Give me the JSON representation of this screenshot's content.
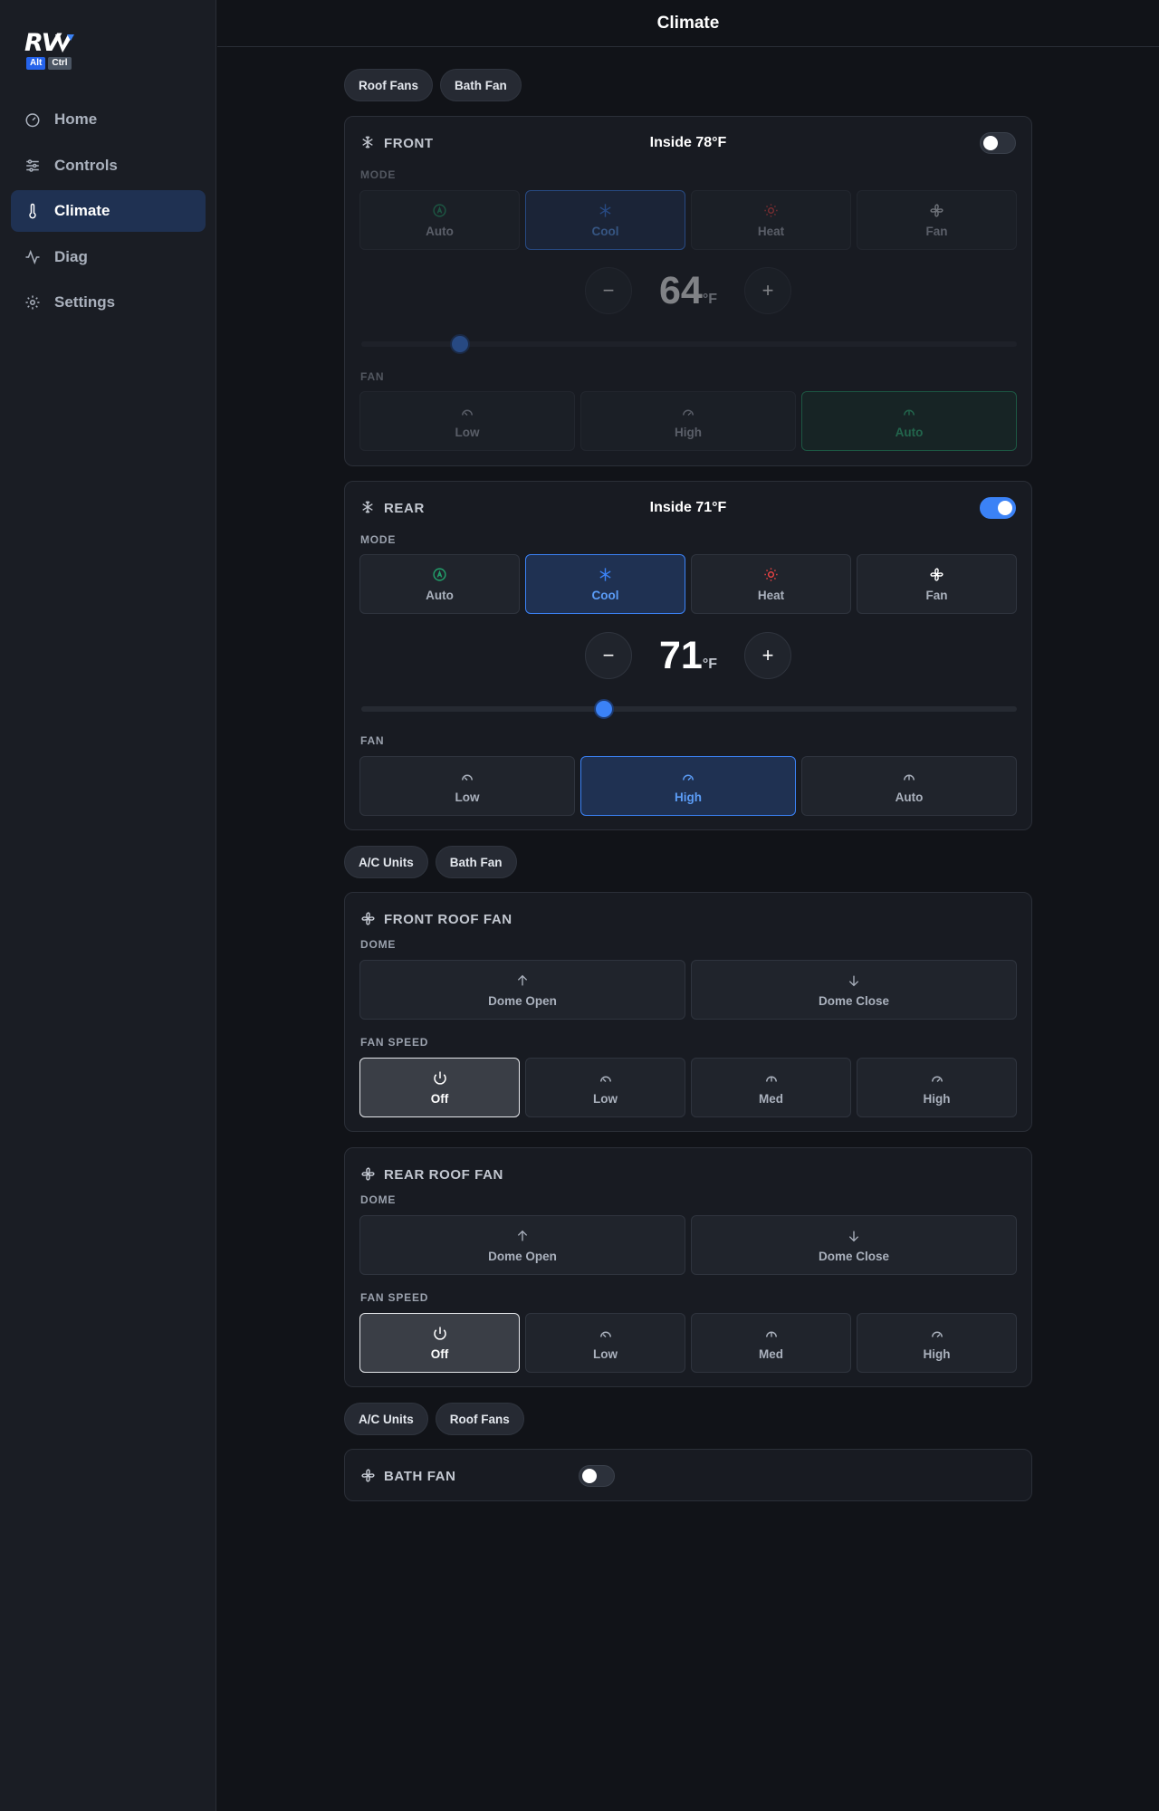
{
  "app": {
    "logo_text": "RV",
    "logo_badges": [
      "Alt",
      "Ctrl"
    ],
    "title": "Climate"
  },
  "sidebar": {
    "items": [
      {
        "label": "Home",
        "icon": "gauge-icon",
        "active": false
      },
      {
        "label": "Controls",
        "icon": "sliders-icon",
        "active": false
      },
      {
        "label": "Climate",
        "icon": "thermometer-icon",
        "active": true
      },
      {
        "label": "Diag",
        "icon": "activity-icon",
        "active": false
      },
      {
        "label": "Settings",
        "icon": "gear-icon",
        "active": false
      }
    ]
  },
  "ac_section": {
    "pills": [
      "Roof Fans",
      "Bath Fan"
    ],
    "front": {
      "name": "FRONT",
      "inside_temp": "Inside 78°F",
      "enabled": false,
      "mode_label": "MODE",
      "modes": [
        "Auto",
        "Cool",
        "Heat",
        "Fan"
      ],
      "selected_mode": "Cool",
      "setpoint": "64",
      "unit": "°F",
      "slider_fraction": 0.15,
      "fan_label": "FAN",
      "fan_options": [
        "Low",
        "High",
        "Auto"
      ],
      "selected_fan": "Auto"
    },
    "rear": {
      "name": "REAR",
      "inside_temp": "Inside 71°F",
      "enabled": true,
      "mode_label": "MODE",
      "modes": [
        "Auto",
        "Cool",
        "Heat",
        "Fan"
      ],
      "selected_mode": "Cool",
      "setpoint": "71",
      "unit": "°F",
      "slider_fraction": 0.37,
      "fan_label": "FAN",
      "fan_options": [
        "Low",
        "High",
        "Auto"
      ],
      "selected_fan": "High"
    }
  },
  "roof_section": {
    "pills": [
      "A/C Units",
      "Bath Fan"
    ],
    "front_fan": {
      "name": "FRONT ROOF FAN",
      "dome_label": "DOME",
      "dome_open": "Dome Open",
      "dome_close": "Dome Close",
      "speed_label": "FAN SPEED",
      "speeds": [
        "Off",
        "Low",
        "Med",
        "High"
      ],
      "selected_speed": "Off"
    },
    "rear_fan": {
      "name": "REAR ROOF FAN",
      "dome_label": "DOME",
      "dome_open": "Dome Open",
      "dome_close": "Dome Close",
      "speed_label": "FAN SPEED",
      "speeds": [
        "Off",
        "Low",
        "Med",
        "High"
      ],
      "selected_speed": "Off"
    }
  },
  "bath_section": {
    "pills": [
      "A/C Units",
      "Roof Fans"
    ],
    "name": "BATH FAN",
    "enabled": false
  },
  "colors": {
    "accent_blue": "#3b82f6",
    "auto_green": "#22a06b",
    "heat_red": "#ef4444",
    "background": "#111318"
  }
}
